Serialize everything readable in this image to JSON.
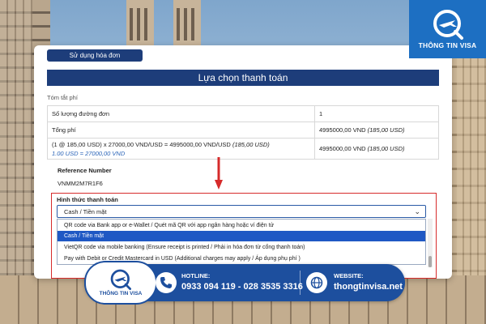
{
  "header": {
    "use_invoice_button": "Sử dụng hóa đơn",
    "title": "Lựa chọn thanh toán"
  },
  "summary": {
    "label": "Tóm tắt phí",
    "rows": [
      {
        "label": "Số lượng đường đơn",
        "value": "1"
      },
      {
        "label": "Tổng phí",
        "value_main": "4995000,00 VND",
        "value_note": "(185,00 USD)"
      },
      {
        "label_main": "(1 @ 185,00 USD) x 27000,00 VND/USD = 4995000,00 VND/USD",
        "label_note": "(185,00 USD)",
        "rate": "1.00 USD = 27000,00 VND",
        "value_main": "4995000,00 VND",
        "value_note": "(185,00 USD)"
      }
    ]
  },
  "reference": {
    "label": "Reference Number",
    "value": "VNMM2M7R1F6"
  },
  "payment": {
    "label": "Hình thức thanh toán",
    "selected": "Cash / Tiền mặt",
    "options": [
      "QR code via Bank app or e-Wallet / Quét mã QR với app ngân hàng hoặc ví điện tử",
      "Cash / Tiền mặt",
      "VietQR code via mobile banking (Ensure receipt is printed / Phải in hóa đơn từ cổng thanh toán)",
      "Pay with Debit or Credit Mastercard in USD (Additional charges may apply / Áp dụng phụ phí )"
    ],
    "highlighted_index": 1,
    "highlight_color": "#d62b2b"
  },
  "brand": {
    "name": "THÔNG TIN VISA",
    "color": "#1d4f9e"
  },
  "banner": {
    "hotline_label": "HOTLINE:",
    "hotline_value": "0933 094 119 - 028 3535 3316",
    "website_label": "WEBSITE:",
    "website_value": "thongtinvisa.net"
  }
}
